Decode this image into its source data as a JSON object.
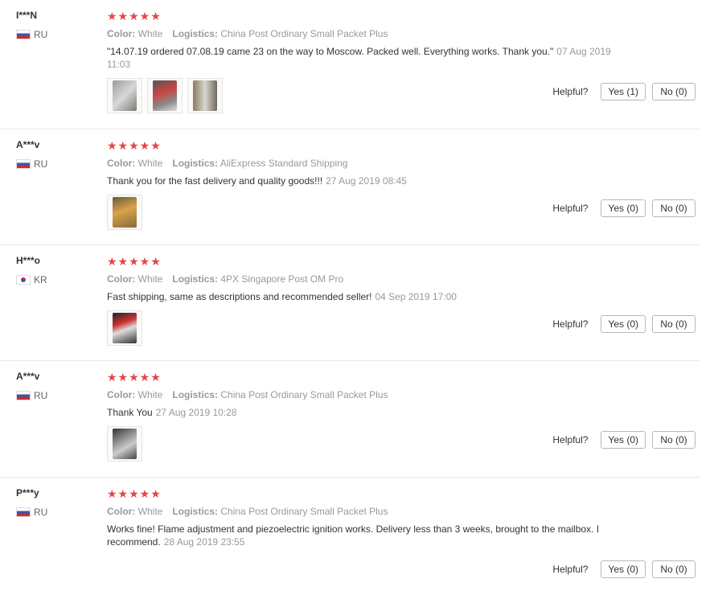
{
  "labels": {
    "color": "Color:",
    "logistics": "Logistics:",
    "helpful": "Helpful?"
  },
  "colors": {
    "star": "#e64545",
    "muted": "#999999",
    "text": "#333333"
  },
  "reviews": [
    {
      "user": "I***N",
      "country": "RU",
      "rating": 5,
      "color": "White",
      "logistics": "China Post Ordinary Small Packet Plus",
      "text": "\"14.07.19 ordered 07.08.19 came 23 on the way to Moscow. Packed well. Everything works. Thank you.\"",
      "time": "07 Aug 2019 11:03",
      "yes": "Yes (1)",
      "no": "No (0)",
      "photos": 3
    },
    {
      "user": "A***v",
      "country": "RU",
      "rating": 5,
      "color": "White",
      "logistics": "AliExpress Standard Shipping",
      "text": "Thank you for the fast delivery and quality goods!!!",
      "time": "27 Aug 2019 08:45",
      "yes": "Yes (0)",
      "no": "No (0)",
      "photos": 1
    },
    {
      "user": "H***o",
      "country": "KR",
      "rating": 5,
      "color": "White",
      "logistics": "4PX Singapore Post OM Pro",
      "text": "Fast shipping, same as descriptions and recommended seller!",
      "time": "04 Sep 2019 17:00",
      "yes": "Yes (0)",
      "no": "No (0)",
      "photos": 1
    },
    {
      "user": "A***v",
      "country": "RU",
      "rating": 5,
      "color": "White",
      "logistics": "China Post Ordinary Small Packet Plus",
      "text": "Thank You",
      "time": "27 Aug 2019 10:28",
      "yes": "Yes (0)",
      "no": "No (0)",
      "photos": 1
    },
    {
      "user": "P***y",
      "country": "RU",
      "rating": 5,
      "color": "White",
      "logistics": "China Post Ordinary Small Packet Plus",
      "text": "Works fine! Flame adjustment and piezoelectric ignition works. Delivery less than 3 weeks, brought to the mailbox. I recommend.",
      "time": "28 Aug 2019 23:55",
      "yes": "Yes (0)",
      "no": "No (0)",
      "photos": 0
    }
  ]
}
